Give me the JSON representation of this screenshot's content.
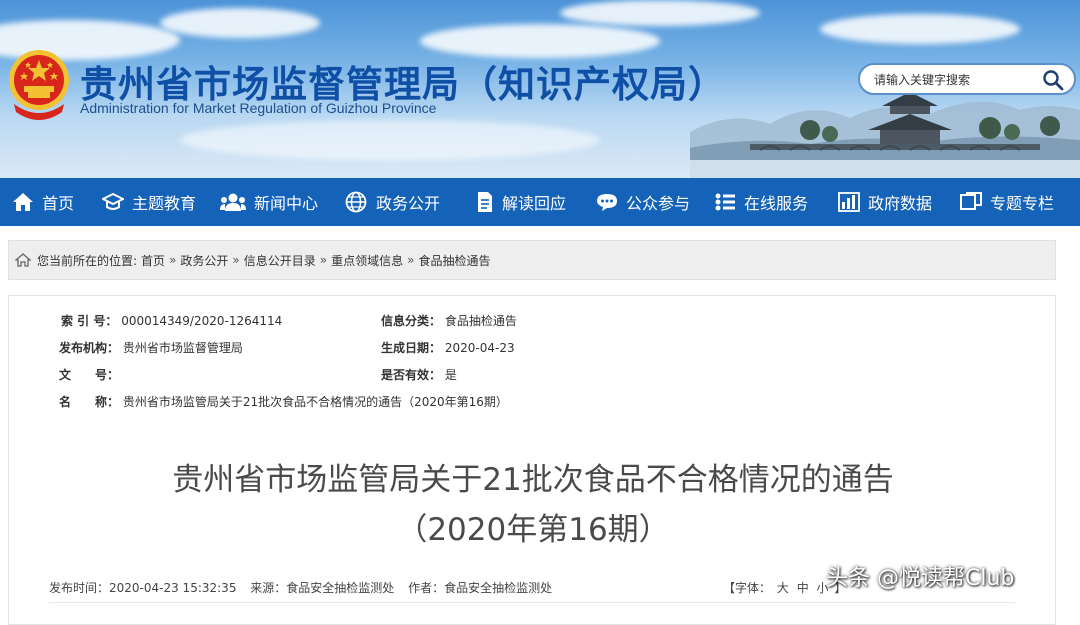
{
  "header": {
    "title": "贵州省市场监督管理局（知识产权局）",
    "subtitle": "Administration for Market Regulation of Guizhou Province",
    "search_placeholder": "请输入关键字搜索"
  },
  "nav": {
    "items": [
      {
        "label": "首页",
        "icon": "home-icon"
      },
      {
        "label": "主题教育",
        "icon": "graduation-cap-icon"
      },
      {
        "label": "新闻中心",
        "icon": "users-icon"
      },
      {
        "label": "政务公开",
        "icon": "globe-icon"
      },
      {
        "label": "解读回应",
        "icon": "document-icon"
      },
      {
        "label": "公众参与",
        "icon": "chat-bubble-icon"
      },
      {
        "label": "在线服务",
        "icon": "list-icon"
      },
      {
        "label": "政府数据",
        "icon": "bar-chart-icon"
      },
      {
        "label": "专题专栏",
        "icon": "window-icon"
      }
    ]
  },
  "breadcrumb": {
    "prefix": "您当前所在的位置:",
    "items": [
      "首页",
      "政务公开",
      "信息公开目录",
      "重点领域信息",
      "食品抽检通告"
    ],
    "separator": "»"
  },
  "meta": {
    "index_label": "索 引 号：",
    "index_value": "000014349/2020-1264114",
    "category_label": "信息分类：",
    "category_value": "食品抽检通告",
    "publisher_label": "发布机构：",
    "publisher_value": "贵州省市场监督管理局",
    "date_label": "生成日期：",
    "date_value": "2020-04-23",
    "docno_label": "文　　号：",
    "docno_value": "",
    "valid_label": "是否有效：",
    "valid_value": "是",
    "name_label": "名　　称：",
    "name_value": "贵州省市场监管局关于21批次食品不合格情况的通告（2020年第16期）"
  },
  "article": {
    "title_line1": "贵州省市场监管局关于21批次食品不合格情况的通告",
    "title_line2": "（2020年第16期）",
    "published": "发布时间：2020-04-23 15:32:35",
    "source": "来源：食品安全抽检监测处",
    "author": "作者：食品安全抽检监测处",
    "fontsize_prefix": "【字体：",
    "fontsize_large": "大",
    "fontsize_medium": "中",
    "fontsize_small": "小",
    "fontsize_suffix": "】"
  },
  "watermark": "头条 @悦读帮Club",
  "colors": {
    "nav_bg": "#1563b8",
    "title_blue": "#0f4fa6",
    "emblem_red": "#d8261c",
    "emblem_gold": "#f2c232"
  }
}
